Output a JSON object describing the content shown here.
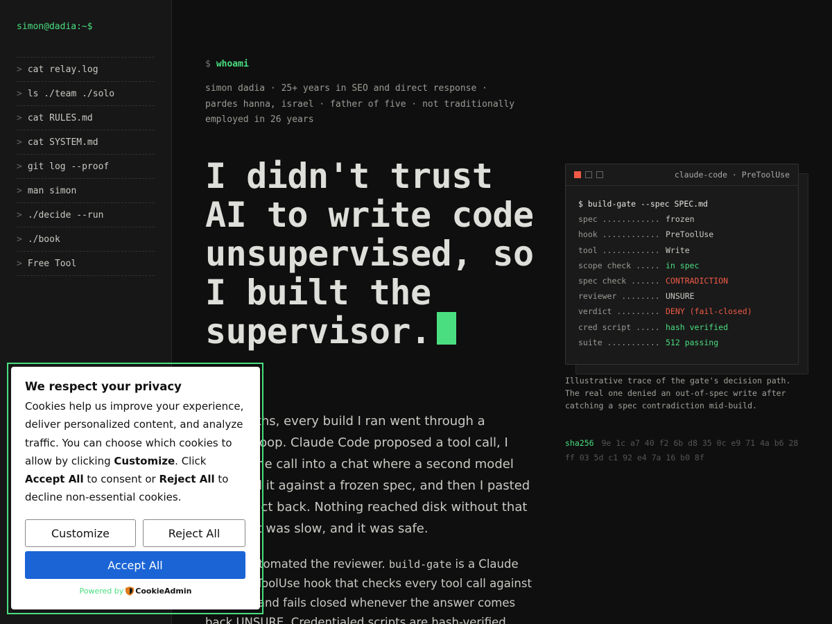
{
  "sidebar": {
    "prompt": "simon@dadia:~$",
    "items": [
      {
        "caret": ">",
        "label": "cat relay.log"
      },
      {
        "caret": ">",
        "label": "ls ./team ./solo"
      },
      {
        "caret": ">",
        "label": "cat RULES.md"
      },
      {
        "caret": ">",
        "label": "cat SYSTEM.md"
      },
      {
        "caret": ">",
        "label": "git log --proof"
      },
      {
        "caret": ">",
        "label": "man simon"
      },
      {
        "caret": ">",
        "label": "./decide --run"
      },
      {
        "caret": ">",
        "label": "./book"
      },
      {
        "caret": ">",
        "label": "Free Tool"
      }
    ]
  },
  "main": {
    "whoami_dollar": "$",
    "whoami_cmd": "whoami",
    "bio_line1": "simon dadia · 25+ years in SEO and direct response ·",
    "bio_line2": "pardes hanna, israel · father of five · not traditionally",
    "bio_line3": "employed in 26 years",
    "headline": "I didn't trust AI to write code unsupervised, so I built the supervisor.",
    "para1": "For months, every build I ran went through a manual loop. Claude Code proposed a tool call, I pasted the call into a chat where a second model reviewed it against a frozen spec, and then I pasted the verdict back. Nothing reached disk without that review. It was slow, and it was safe.",
    "para2_start": "Then I automated the reviewer. ",
    "para2_code": "build-gate",
    "para2_end": " is a Claude Code PreToolUse hook that checks every tool call against the spec and fails closed whenever the answer comes back UNSURE. Credentialed scripts are hash-verified before they run."
  },
  "terminal": {
    "title": "claude-code · PreToolUse",
    "command": "$ build-gate --spec SPEC.md",
    "rows": [
      {
        "key": "spec ............",
        "value": "frozen",
        "tone": "plain"
      },
      {
        "key": "hook ............",
        "value": "PreToolUse",
        "tone": "plain"
      },
      {
        "key": "tool ............",
        "value": "Write",
        "tone": "plain"
      },
      {
        "key": "scope check .....",
        "value": "in spec",
        "tone": "green"
      },
      {
        "key": "spec check ......",
        "value": "CONTRADICTION",
        "tone": "red"
      },
      {
        "key": "reviewer ........",
        "value": "UNSURE",
        "tone": "plain"
      },
      {
        "key": "verdict .........",
        "value": "DENY (fail-closed)",
        "tone": "red"
      },
      {
        "key": "cred script .....",
        "value": "hash verified",
        "tone": "green"
      },
      {
        "key": "suite ...........",
        "value": "512 passing",
        "tone": "green"
      }
    ],
    "caption": "Illustrative trace of the gate's decision path. The real one denied an out-of-spec write after catching a spec contradiction mid-build.",
    "sha_label": "sha256",
    "sha_value": "9e 1c a7 40 f2 6b d8 35 0c e9 71 4a b6 28 ff 03 5d c1 92 e4 7a 16 b0 8f"
  },
  "cookie": {
    "title": "We respect your privacy",
    "text_a": "Cookies help us improve your experience, deliver personalized content, and analyze traffic. You can choose which cookies to allow by clicking ",
    "text_b": "Customize",
    "text_c": ". Click ",
    "text_d": "Accept All",
    "text_e": " to consent or ",
    "text_f": "Reject All",
    "text_g": " to decline non-essential cookies.",
    "customize_label": "Customize",
    "reject_label": "Reject All",
    "accept_label": "Accept All",
    "powered_by": "Powered by",
    "brand": "CookieAdmin"
  },
  "colors": {
    "accent": "#4ade80",
    "danger": "#f05a47",
    "accept_button": "#1a64d6",
    "background": "#0f0f0f"
  }
}
